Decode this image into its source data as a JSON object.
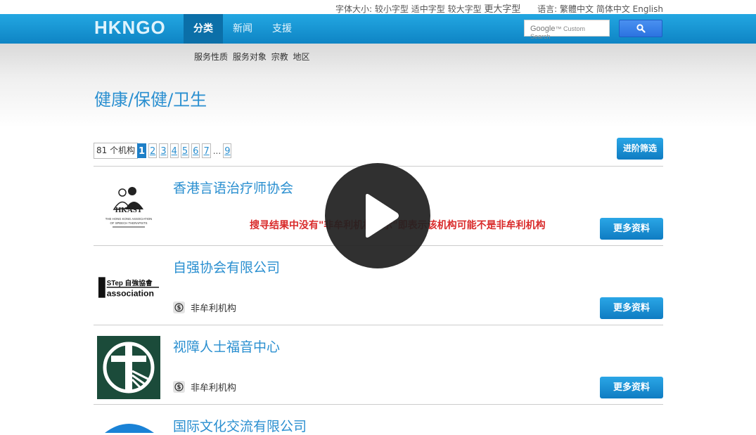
{
  "util": {
    "font_label": "字体大小:",
    "font_sizes": [
      "较小字型",
      "适中字型",
      "较大字型",
      "更大字型"
    ],
    "lang_label": "语言:",
    "languages": [
      "繁體中文",
      "简体中文",
      "English"
    ]
  },
  "header": {
    "logo": "HKNGO",
    "tabs": [
      "分类",
      "新闻",
      "支援"
    ],
    "active_tab": 0,
    "search": {
      "brand": "Google",
      "placeholder": "Custom Search"
    }
  },
  "subnav": [
    "服务性质",
    "服务对象",
    "宗教",
    "地区"
  ],
  "page_title": "健康/保健/卫生",
  "toolbar": {
    "count": "81 个机构",
    "pages": [
      "1",
      "2",
      "3",
      "4",
      "5",
      "6",
      "7"
    ],
    "ellipsis": "...",
    "last_page": "9",
    "current_page": "1",
    "advanced_filter": "进阶筛选"
  },
  "notice": "搜寻结果中没有\"非牟利机构标示\"即表示该机构可能不是非牟利机构",
  "more_label": "更多资料",
  "nonprofit_label": "非牟利机构",
  "rows": [
    {
      "name": "香港言语治疗师协会",
      "logo_text": "HKAST",
      "logo_caption_1": "THE HONG KONG ASSOCIATION",
      "logo_caption_2": "OF SPEECH THERAPISTS",
      "nonprofit": false
    },
    {
      "name": "自强协会有限公司",
      "logo_text_1": "STep 自強協會",
      "logo_text_2": "association",
      "nonprofit": true
    },
    {
      "name": "视障人士福音中心",
      "nonprofit": true
    },
    {
      "name": "国际文化交流有限公司",
      "nonprofit": false
    }
  ],
  "colors": {
    "header": "#1593d3",
    "link": "#2a8fd0",
    "notice": "#d92b2b",
    "button": "#1a8fd4"
  }
}
